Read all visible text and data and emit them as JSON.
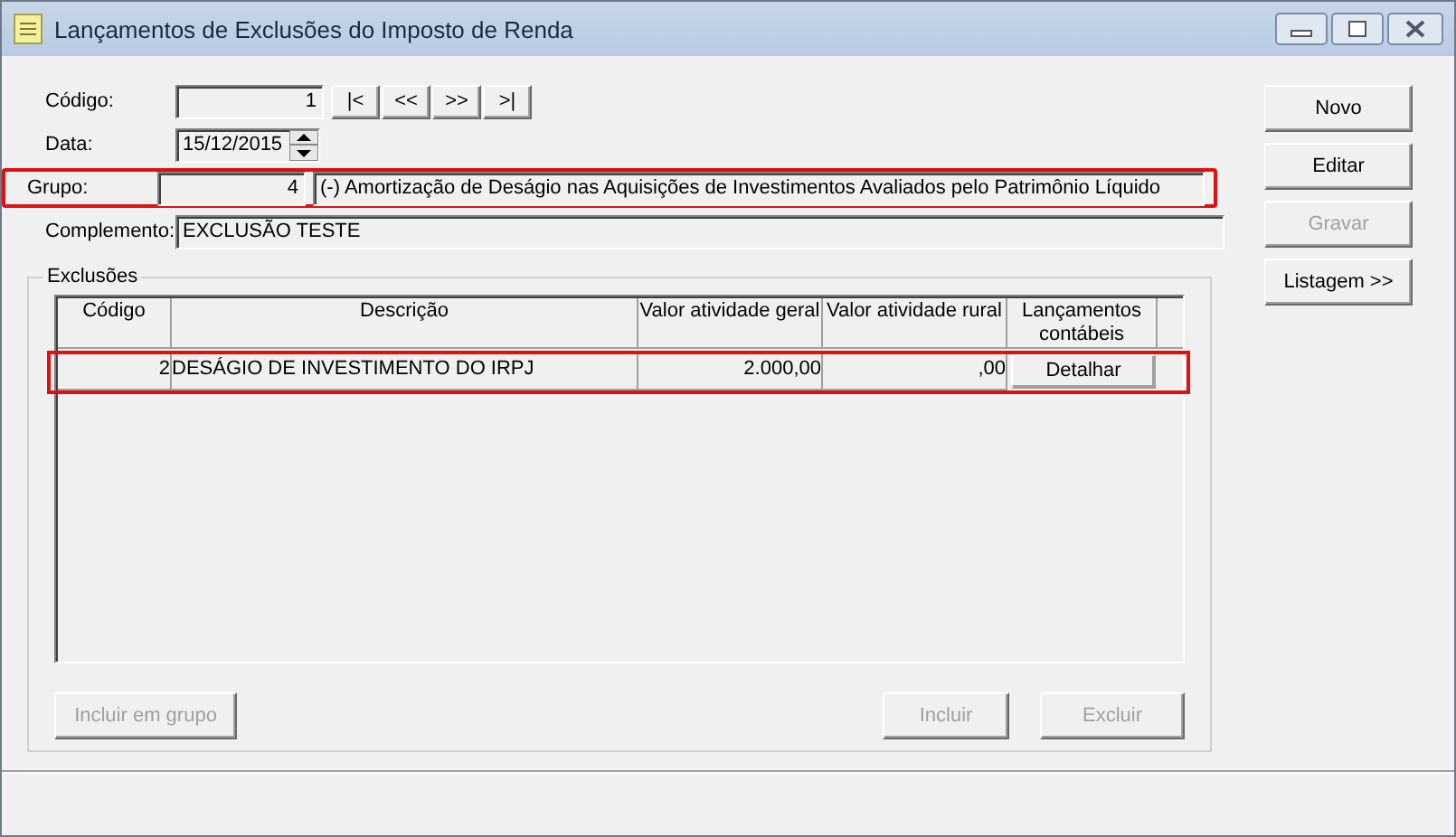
{
  "window": {
    "title": "Lançamentos de Exclusões do Imposto de Renda"
  },
  "codigo": {
    "label": "Código:",
    "value": "1"
  },
  "nav_buttons": [
    "|<",
    "<<",
    ">>",
    ">|"
  ],
  "data": {
    "label": "Data:",
    "value": "15/12/2015"
  },
  "grupo": {
    "label": "Grupo:",
    "code": "4",
    "description": "(-) Amortização de Deságio nas Aquisições de Investimentos Avaliados pelo Patrimônio Líquido",
    "highlighted": true
  },
  "complemento": {
    "label": "Complemento:",
    "value": "EXCLUSÃO TESTE"
  },
  "side_buttons": [
    {
      "label": "Novo",
      "disabled": false
    },
    {
      "label": "Editar",
      "disabled": false
    },
    {
      "label": "Gravar",
      "disabled": true
    },
    {
      "label": "Listagem >>",
      "disabled": false
    }
  ],
  "exclusoes": {
    "title": "Exclusões",
    "columns": [
      "Código",
      "Descrição",
      "Valor atividade geral",
      "Valor atividade rural",
      "Lançamentos contábeis"
    ],
    "rows": [
      {
        "codigo": "2",
        "descricao": "DESÁGIO DE INVESTIMENTO DO IRPJ",
        "valor_geral": "2.000,00",
        "valor_rural": ",00",
        "action": "Detalhar",
        "highlighted": true
      }
    ],
    "buttons": [
      {
        "label": "Incluir em grupo",
        "disabled": true
      },
      {
        "label": "Incluir",
        "disabled": true
      },
      {
        "label": "Excluir",
        "disabled": true
      }
    ]
  }
}
